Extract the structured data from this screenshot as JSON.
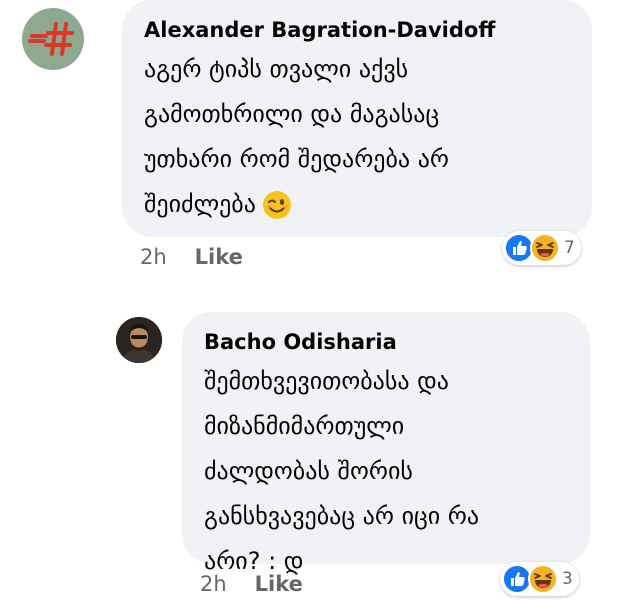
{
  "comments": [
    {
      "author": "Alexander Bagration-Davidoff",
      "text": "აგერ ტიპს თვალი აქვს\nგამოთხრილი და მაგასაც\nუთხარი რომ შედარება არ\nშეიძლება",
      "emoji_icon": "winking-face-icon",
      "time": "2h",
      "like_label": "Like",
      "reaction_icons": [
        "like-reaction-icon",
        "haha-reaction-icon"
      ],
      "reaction_count": "7",
      "avatar_icon": "red-hashtag-logo-icon"
    },
    {
      "author": "Bacho Odisharia",
      "text": "შემთხვევითობასა და\nმიზანმიმართული\nძალდობას შორის\nგანსხვავებაც არ იცი რა\nარი? : დ",
      "time": "2h",
      "like_label": "Like",
      "reaction_icons": [
        "like-reaction-icon",
        "haha-reaction-icon"
      ],
      "reaction_count": "3",
      "avatar_icon": "profile-photo-icon"
    }
  ],
  "colors": {
    "bubble_bg": "#f0f2f5",
    "meta_text": "#65676b",
    "like_blue": "#1877f2",
    "haha_yellow": "#f7b125",
    "avatar1_bg": "#8fa98e",
    "avatar1_logo": "#d9382c"
  }
}
